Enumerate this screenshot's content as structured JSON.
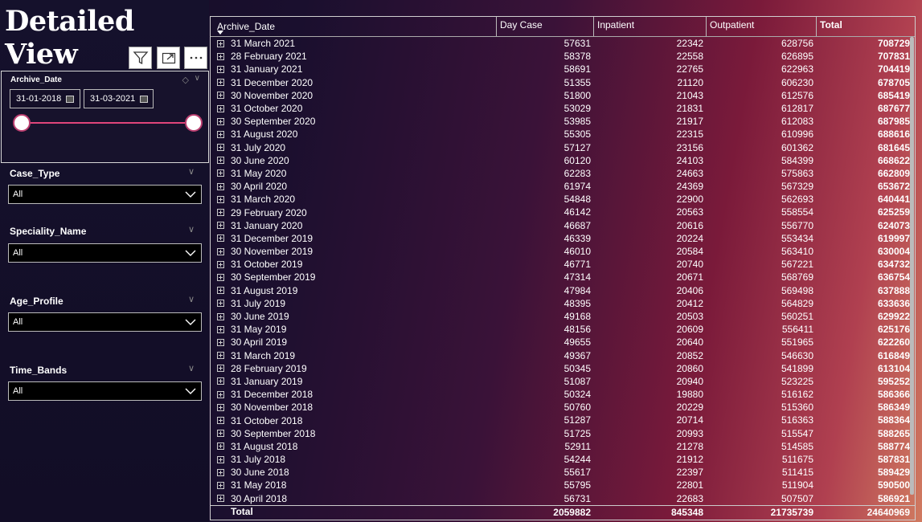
{
  "title": "Detailed View",
  "slicers": {
    "archive_date": {
      "label": "Archive_Date",
      "from": "31-01-2018",
      "to": "31-03-2021"
    },
    "case_type": {
      "label": "Case_Type",
      "value": "All"
    },
    "speciality_name": {
      "label": "Speciality_Name",
      "value": "All"
    },
    "age_profile": {
      "label": "Age_Profile",
      "value": "All"
    },
    "time_bands": {
      "label": "Time_Bands",
      "value": "All"
    }
  },
  "table": {
    "headers": [
      "Archive_Date",
      "Day Case",
      "Inpatient",
      "Outpatient",
      "Total"
    ],
    "rows": [
      [
        "31 March 2021",
        "57631",
        "22342",
        "628756",
        "708729"
      ],
      [
        "28 February 2021",
        "58378",
        "22558",
        "626895",
        "707831"
      ],
      [
        "31 January 2021",
        "58691",
        "22765",
        "622963",
        "704419"
      ],
      [
        "31 December 2020",
        "51355",
        "21120",
        "606230",
        "678705"
      ],
      [
        "30 November 2020",
        "51800",
        "21043",
        "612576",
        "685419"
      ],
      [
        "31 October 2020",
        "53029",
        "21831",
        "612817",
        "687677"
      ],
      [
        "30 September 2020",
        "53985",
        "21917",
        "612083",
        "687985"
      ],
      [
        "31 August 2020",
        "55305",
        "22315",
        "610996",
        "688616"
      ],
      [
        "31 July 2020",
        "57127",
        "23156",
        "601362",
        "681645"
      ],
      [
        "30 June 2020",
        "60120",
        "24103",
        "584399",
        "668622"
      ],
      [
        "31 May 2020",
        "62283",
        "24663",
        "575863",
        "662809"
      ],
      [
        "30 April 2020",
        "61974",
        "24369",
        "567329",
        "653672"
      ],
      [
        "31 March 2020",
        "54848",
        "22900",
        "562693",
        "640441"
      ],
      [
        "29 February 2020",
        "46142",
        "20563",
        "558554",
        "625259"
      ],
      [
        "31 January 2020",
        "46687",
        "20616",
        "556770",
        "624073"
      ],
      [
        "31 December 2019",
        "46339",
        "20224",
        "553434",
        "619997"
      ],
      [
        "30 November 2019",
        "46010",
        "20584",
        "563410",
        "630004"
      ],
      [
        "31 October 2019",
        "46771",
        "20740",
        "567221",
        "634732"
      ],
      [
        "30 September 2019",
        "47314",
        "20671",
        "568769",
        "636754"
      ],
      [
        "31 August 2019",
        "47984",
        "20406",
        "569498",
        "637888"
      ],
      [
        "31 July 2019",
        "48395",
        "20412",
        "564829",
        "633636"
      ],
      [
        "30 June 2019",
        "49168",
        "20503",
        "560251",
        "629922"
      ],
      [
        "31 May 2019",
        "48156",
        "20609",
        "556411",
        "625176"
      ],
      [
        "30 April 2019",
        "49655",
        "20640",
        "551965",
        "622260"
      ],
      [
        "31 March 2019",
        "49367",
        "20852",
        "546630",
        "616849"
      ],
      [
        "28 February 2019",
        "50345",
        "20860",
        "541899",
        "613104"
      ],
      [
        "31 January 2019",
        "51087",
        "20940",
        "523225",
        "595252"
      ],
      [
        "31 December 2018",
        "50324",
        "19880",
        "516162",
        "586366"
      ],
      [
        "30 November 2018",
        "50760",
        "20229",
        "515360",
        "586349"
      ],
      [
        "31 October 2018",
        "51287",
        "20714",
        "516363",
        "588364"
      ],
      [
        "30 September 2018",
        "51725",
        "20993",
        "515547",
        "588265"
      ],
      [
        "31 August 2018",
        "52911",
        "21278",
        "514585",
        "588774"
      ],
      [
        "31 July 2018",
        "54244",
        "21912",
        "511675",
        "587831"
      ],
      [
        "30 June 2018",
        "55617",
        "22397",
        "511415",
        "589429"
      ],
      [
        "31 May 2018",
        "55795",
        "22801",
        "511904",
        "590500"
      ],
      [
        "30 April 2018",
        "56731",
        "22683",
        "507507",
        "586921"
      ]
    ],
    "total": [
      "Total",
      "2059882",
      "845348",
      "21735739",
      "24640969"
    ]
  }
}
